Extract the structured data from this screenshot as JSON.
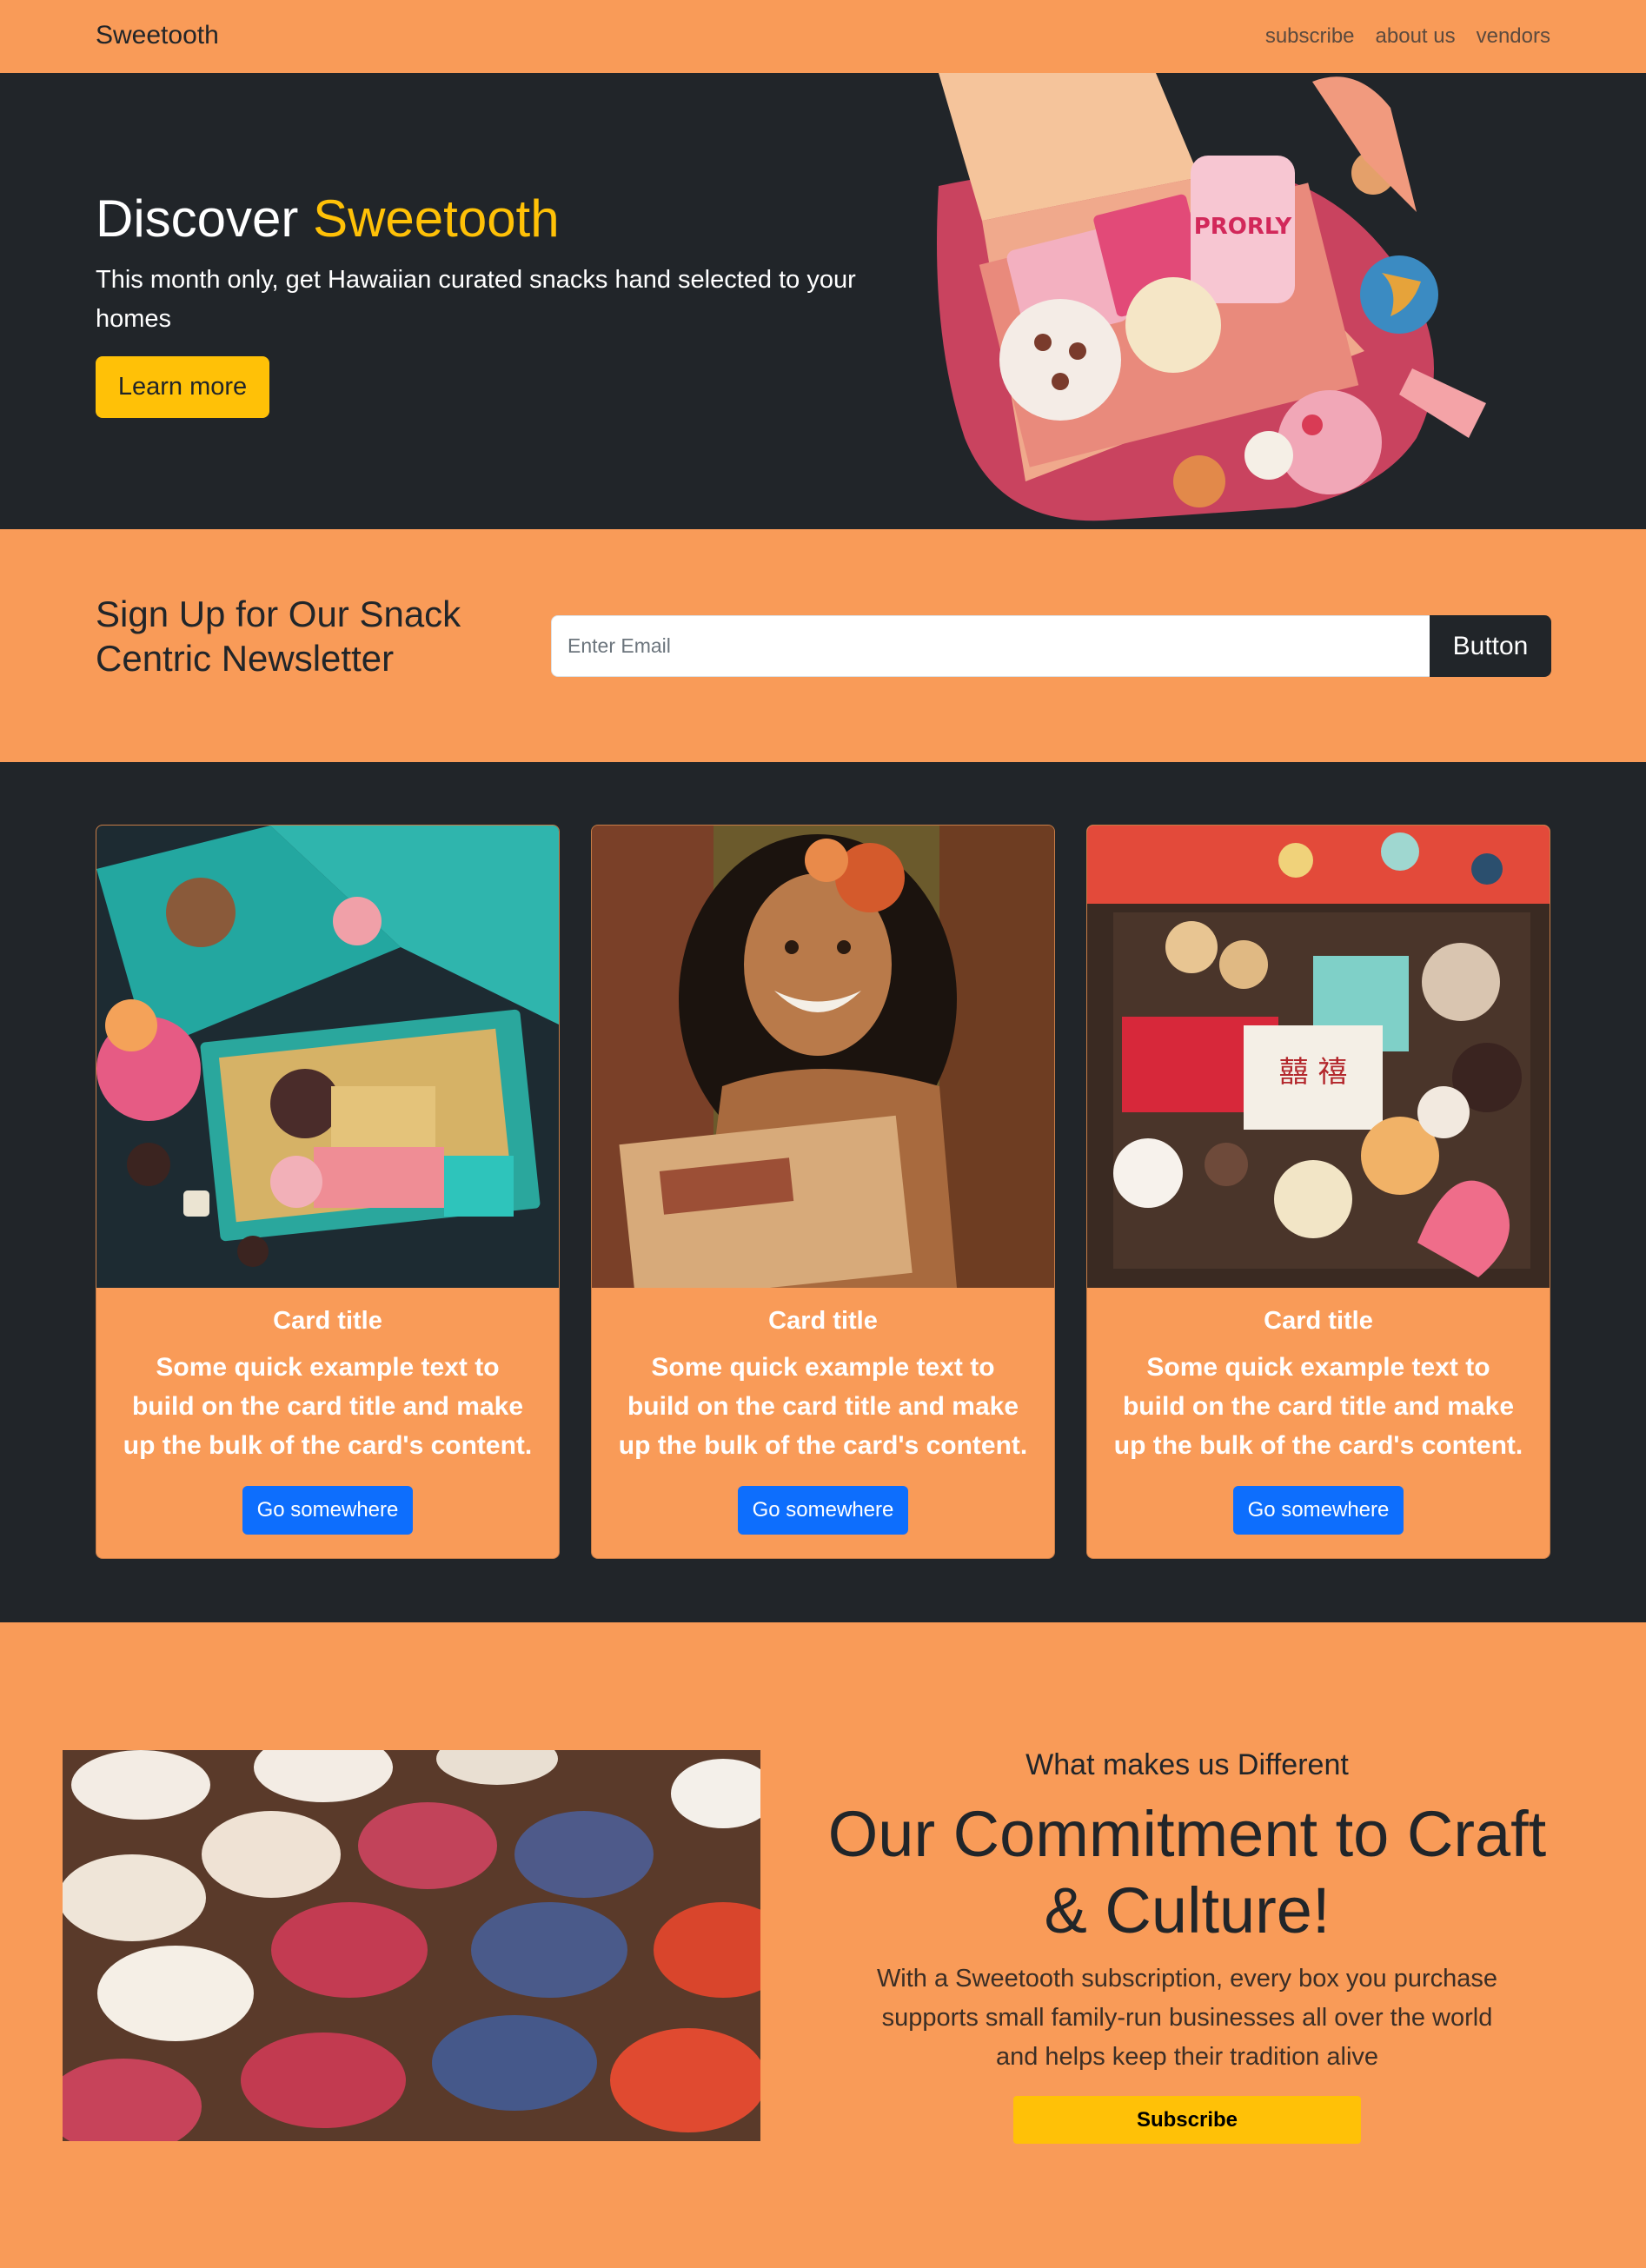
{
  "colors": {
    "orange": "#f99b58",
    "dark": "#212529",
    "yellow": "#ffc107",
    "blue": "#0d6efd"
  },
  "nav": {
    "brand": "Sweetooth",
    "links": [
      "subscribe",
      "about us",
      "vendors"
    ]
  },
  "hero": {
    "title_prefix": "Discover",
    "title_accent": "Sweetooth",
    "text": "This month only, get Hawaiian curated snacks hand selected to your homes",
    "button": "Learn more"
  },
  "newsletter": {
    "title": "Sign Up for Our Snack Centric Newsletter",
    "placeholder": "Enter Email",
    "button": "Button"
  },
  "cards": [
    {
      "title": "Card title",
      "text": "Some quick example text to build on the card title and make up the bulk of the card's content.",
      "button": "Go somewhere"
    },
    {
      "title": "Card title",
      "text": "Some quick example text to build on the card title and make up the bulk of the card's content.",
      "button": "Go somewhere"
    },
    {
      "title": "Card title",
      "text": "Some quick example text to build on the card title and make up the bulk of the card's content.",
      "button": "Go somewhere"
    }
  ],
  "feature": {
    "subtitle": "What makes us Different",
    "title": "Our Commitment to Craft & Culture!",
    "text": "With a Sweetooth subscription, every box you purchase supports small family-run businesses all over the world and helps keep their tradition alive",
    "button": "Subscribe"
  }
}
